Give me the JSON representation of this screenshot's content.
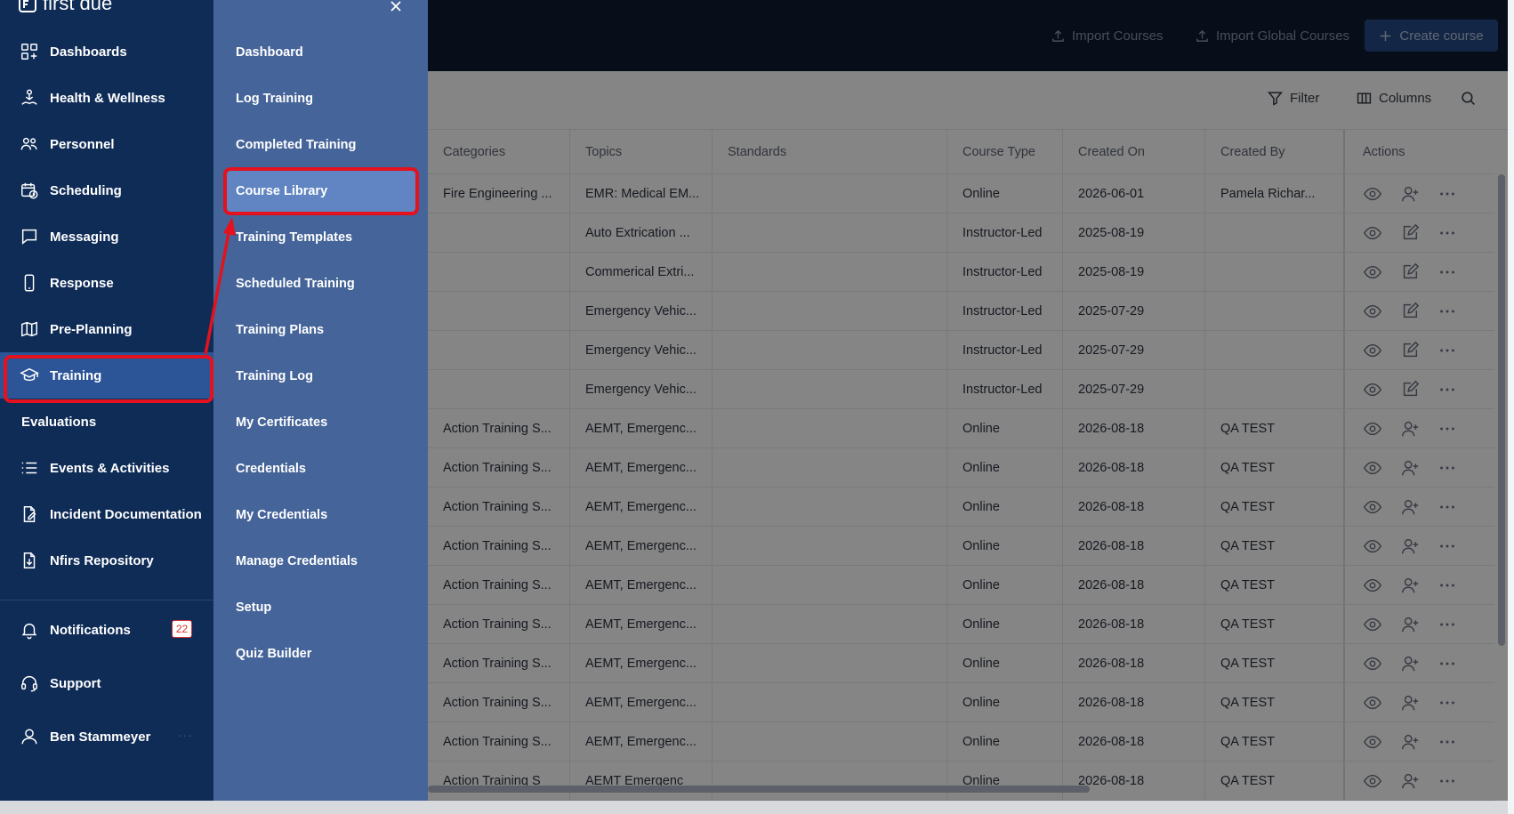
{
  "brand": {
    "logo_text": "first due"
  },
  "header": {
    "import_courses": "Import Courses",
    "import_global_courses": "Import Global Courses",
    "create_course": "Create course"
  },
  "toolbar": {
    "filter": "Filter",
    "columns": "Columns"
  },
  "table": {
    "headers": [
      "Categories",
      "Topics",
      "Standards",
      "Course Type",
      "Created On",
      "Created By",
      "Actions"
    ],
    "rows": [
      {
        "category": "Fire Engineering ...",
        "topic": "EMR: Medical EM...",
        "standards": "",
        "type": "Online",
        "created_on": "2026-06-01",
        "created_by": "Pamela Richar...",
        "second_action": "assign-user-icon"
      },
      {
        "category": "",
        "topic": "Auto Extrication ...",
        "standards": "",
        "type": "Instructor-Led",
        "created_on": "2025-08-19",
        "created_by": "",
        "second_action": "edit-icon"
      },
      {
        "category": "",
        "topic": "Commerical Extri...",
        "standards": "",
        "type": "Instructor-Led",
        "created_on": "2025-08-19",
        "created_by": "",
        "second_action": "edit-icon"
      },
      {
        "category": "",
        "topic": "Emergency Vehic...",
        "standards": "",
        "type": "Instructor-Led",
        "created_on": "2025-07-29",
        "created_by": "",
        "second_action": "edit-icon"
      },
      {
        "category": "",
        "topic": "Emergency Vehic...",
        "standards": "",
        "type": "Instructor-Led",
        "created_on": "2025-07-29",
        "created_by": "",
        "second_action": "edit-icon"
      },
      {
        "category": "",
        "topic": "Emergency Vehic...",
        "standards": "",
        "type": "Instructor-Led",
        "created_on": "2025-07-29",
        "created_by": "",
        "second_action": "edit-icon"
      },
      {
        "category": "Action Training S...",
        "topic": "AEMT, Emergenc...",
        "standards": "",
        "type": "Online",
        "created_on": "2026-08-18",
        "created_by": "QA TEST",
        "second_action": "assign-user-icon"
      },
      {
        "category": "Action Training S...",
        "topic": "AEMT, Emergenc...",
        "standards": "",
        "type": "Online",
        "created_on": "2026-08-18",
        "created_by": "QA TEST",
        "second_action": "assign-user-icon"
      },
      {
        "category": "Action Training S...",
        "topic": "AEMT, Emergenc...",
        "standards": "",
        "type": "Online",
        "created_on": "2026-08-18",
        "created_by": "QA TEST",
        "second_action": "assign-user-icon"
      },
      {
        "category": "Action Training S...",
        "topic": "AEMT, Emergenc...",
        "standards": "",
        "type": "Online",
        "created_on": "2026-08-18",
        "created_by": "QA TEST",
        "second_action": "assign-user-icon"
      },
      {
        "category": "Action Training S...",
        "topic": "AEMT, Emergenc...",
        "standards": "",
        "type": "Online",
        "created_on": "2026-08-18",
        "created_by": "QA TEST",
        "second_action": "assign-user-icon"
      },
      {
        "category": "Action Training S...",
        "topic": "AEMT, Emergenc...",
        "standards": "",
        "type": "Online",
        "created_on": "2026-08-18",
        "created_by": "QA TEST",
        "second_action": "assign-user-icon"
      },
      {
        "category": "Action Training S...",
        "topic": "AEMT, Emergenc...",
        "standards": "",
        "type": "Online",
        "created_on": "2026-08-18",
        "created_by": "QA TEST",
        "second_action": "assign-user-icon"
      },
      {
        "category": "Action Training S...",
        "topic": "AEMT, Emergenc...",
        "standards": "",
        "type": "Online",
        "created_on": "2026-08-18",
        "created_by": "QA TEST",
        "second_action": "assign-user-icon"
      },
      {
        "category": "Action Training S...",
        "topic": "AEMT, Emergenc...",
        "standards": "",
        "type": "Online",
        "created_on": "2026-08-18",
        "created_by": "QA TEST",
        "second_action": "assign-user-icon"
      },
      {
        "category": "Action Training S",
        "topic": "AEMT Emergenc",
        "standards": "",
        "type": "Online",
        "created_on": "2026-08-18",
        "created_by": "QA TEST",
        "second_action": "assign-user-icon"
      }
    ]
  },
  "sidebar": {
    "items": [
      {
        "label": "Dashboards",
        "icon": "dashboard-icon"
      },
      {
        "label": "Health & Wellness",
        "icon": "wellness-icon"
      },
      {
        "label": "Personnel",
        "icon": "people-icon"
      },
      {
        "label": "Scheduling",
        "icon": "calendar-clock-icon"
      },
      {
        "label": "Messaging",
        "icon": "message-icon"
      },
      {
        "label": "Response",
        "icon": "phone-icon"
      },
      {
        "label": "Pre-Planning",
        "icon": "map-icon"
      },
      {
        "label": "Training",
        "icon": "graduation-cap-icon"
      },
      {
        "label": "Evaluations",
        "icon": ""
      },
      {
        "label": "Events & Activities",
        "icon": "list-icon"
      },
      {
        "label": "Incident Documentation",
        "icon": "document-edit-icon"
      },
      {
        "label": "Nfirs Repository",
        "icon": "document-download-icon"
      }
    ],
    "footer": {
      "notifications": "Notifications",
      "notifications_count": "22",
      "support": "Support",
      "user": "Ben Stammeyer",
      "user_more": "···"
    }
  },
  "submenu": {
    "items": [
      "Dashboard",
      "Log Training",
      "Completed Training",
      "Course Library",
      "Training Templates",
      "Scheduled Training",
      "Training Plans",
      "Training Log",
      "My Certificates",
      "Credentials",
      "My Credentials",
      "Manage Credentials",
      "Setup",
      "Quiz Builder"
    ]
  },
  "colors": {
    "sidebar_bg": "#0f2c57",
    "submenu_bg": "#456499",
    "active_item": "#2c5597",
    "annotation_red": "#e3121e",
    "create_button": "#254a87"
  }
}
